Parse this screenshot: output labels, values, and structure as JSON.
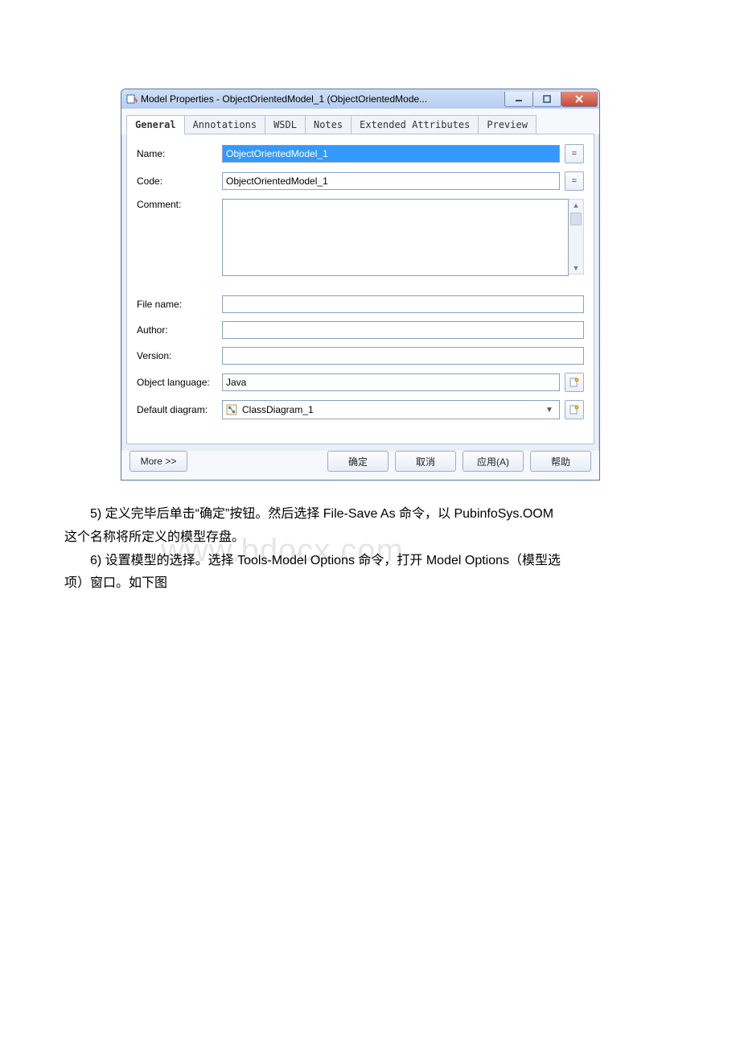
{
  "window": {
    "title": "Model Properties - ObjectOrientedModel_1 (ObjectOrientedMode..."
  },
  "tabs": {
    "general": "General",
    "annotations": "Annotations",
    "wsdl": "WSDL",
    "notes": "Notes",
    "extended": "Extended Attributes",
    "preview": "Preview"
  },
  "labels": {
    "name": "Name:",
    "code": "Code:",
    "comment": "Comment:",
    "filename": "File name:",
    "author": "Author:",
    "version": "Version:",
    "objlang": "Object language:",
    "defdiagram": "Default diagram:"
  },
  "fields": {
    "name": "ObjectOrientedModel_1",
    "code": "ObjectOrientedModel_1",
    "comment": "",
    "filename": "",
    "author": "",
    "version": "",
    "objlang": "Java",
    "defdiagram": "ClassDiagram_1"
  },
  "buttons": {
    "eq": "=",
    "more": "More >>",
    "ok": "确定",
    "cancel": "取消",
    "apply": "应用(A)",
    "help": "帮助"
  },
  "body": {
    "p1a": "5) 定义完毕后单击“确定”按钮。然后选择 File-Save As 命令，以 PubinfoSys.OOM",
    "p1b": "这个名称将所定义的模型存盘。",
    "p2a": "6) 设置模型的选择。选择 Tools-Model Options 命令，打开 Model Options（模型选",
    "p2b": "项）窗口。如下图"
  },
  "watermark": "www.bdocx.com"
}
